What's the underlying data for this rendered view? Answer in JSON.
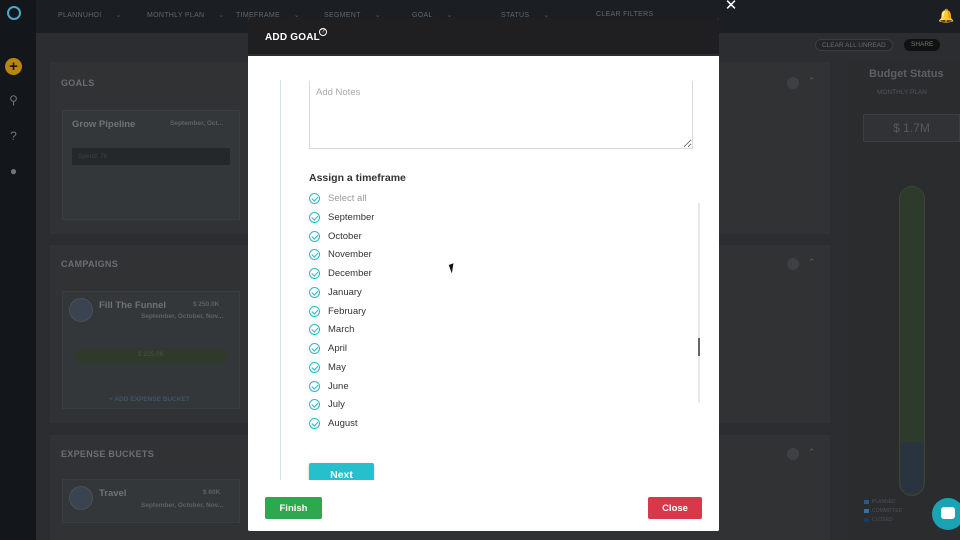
{
  "topbar": {
    "filters": [
      "PLANNUHOI",
      "MONTHLY PLAN",
      "TIMEFRAME",
      "SEGMENT",
      "GOAL",
      "STATUS",
      "CLEAR FILTERS"
    ]
  },
  "subbar": {
    "clear_all_label": "CLEAR ALL UNREAD",
    "share_label": "SHARE"
  },
  "background": {
    "goals": {
      "title": "GOALS",
      "card_title": "Grow Pipeline",
      "card_sub": "September, Oct...",
      "bar_label": "Spend: 7k"
    },
    "campaigns": {
      "title": "CAMPAIGNS",
      "card_title": "Fill The Funnel",
      "card_amount": "$ 250.0K",
      "card_sub": "September, October, Nov...",
      "bar_value": "$ 225.0K",
      "add_link": "+ ADD EXPENSE BUCKET"
    },
    "expense_buckets": {
      "title": "EXPENSE BUCKETS",
      "card_title": "Travel",
      "card_amount": "$ 60K",
      "card_sub": "September, October, Nov..."
    },
    "budget": {
      "title": "Budget Status",
      "select": "MONTHLY PLAN",
      "amount": "$ 1.7M",
      "legend": [
        "PLANNED",
        "COMMITTED",
        "CLOSED"
      ]
    }
  },
  "modal": {
    "title": "ADD GOAL",
    "help_icon": "question-circle-icon",
    "notes_placeholder": "Add Notes",
    "timeframe_label": "Assign a timeframe",
    "months": [
      {
        "label": "Select all",
        "checked": true
      },
      {
        "label": "September",
        "checked": true
      },
      {
        "label": "October",
        "checked": true
      },
      {
        "label": "November",
        "checked": true
      },
      {
        "label": "December",
        "checked": true
      },
      {
        "label": "January",
        "checked": true
      },
      {
        "label": "February",
        "checked": true
      },
      {
        "label": "March",
        "checked": true
      },
      {
        "label": "April",
        "checked": true
      },
      {
        "label": "May",
        "checked": true
      },
      {
        "label": "June",
        "checked": true
      },
      {
        "label": "July",
        "checked": true
      },
      {
        "label": "August",
        "checked": true
      }
    ],
    "next_label": "Next",
    "finish_label": "Finish",
    "close_label": "Close"
  },
  "colors": {
    "accent": "#26c0cc",
    "finish": "#2ea84e",
    "close": "#d8394a",
    "header": "#1f1f22"
  }
}
